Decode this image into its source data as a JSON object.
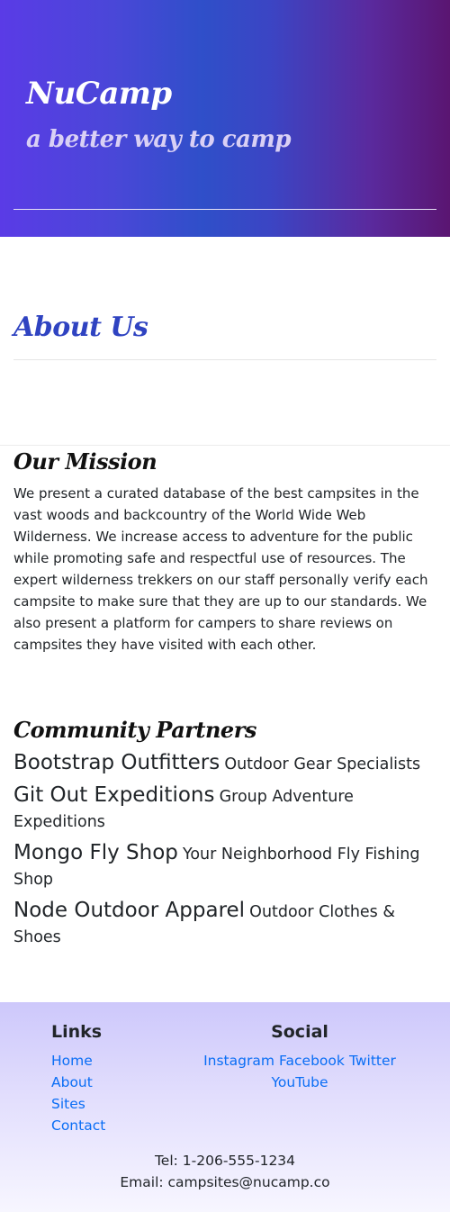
{
  "header": {
    "brand": "NuCamp",
    "tagline": "a better way to camp"
  },
  "about": {
    "title": "About Us"
  },
  "mission": {
    "title": "Our Mission",
    "text": "We present a curated database of the best campsites in the vast woods and backcountry of the World Wide Web Wilderness. We increase access to adventure for the public while promoting safe and respectful use of resources. The expert wilderness trekkers on our staff personally verify each campsite to make sure that they are up to our standards. We also present a platform for campers to share reviews on campsites they have visited with each other."
  },
  "partners": {
    "title": "Community Partners",
    "items": [
      {
        "name": "Bootstrap Outfitters",
        "description": "Outdoor Gear Specialists"
      },
      {
        "name": "Git Out Expeditions",
        "description": "Group Adventure Expeditions"
      },
      {
        "name": "Mongo Fly Shop",
        "description": "Your Neighborhood Fly Fishing Shop"
      },
      {
        "name": "Node Outdoor Apparel",
        "description": "Outdoor Clothes & Shoes"
      }
    ]
  },
  "footer": {
    "links_title": "Links",
    "links": [
      "Home",
      "About",
      "Sites",
      "Contact"
    ],
    "social_title": "Social",
    "social": [
      "Instagram",
      "Facebook",
      "Twitter",
      "YouTube"
    ],
    "phone": "Tel: 1-206-555-1234",
    "email": "Email: campsites@nucamp.co"
  },
  "colors": {
    "brand_link": "#0a6ef5",
    "about_title": "#2f43c1"
  }
}
